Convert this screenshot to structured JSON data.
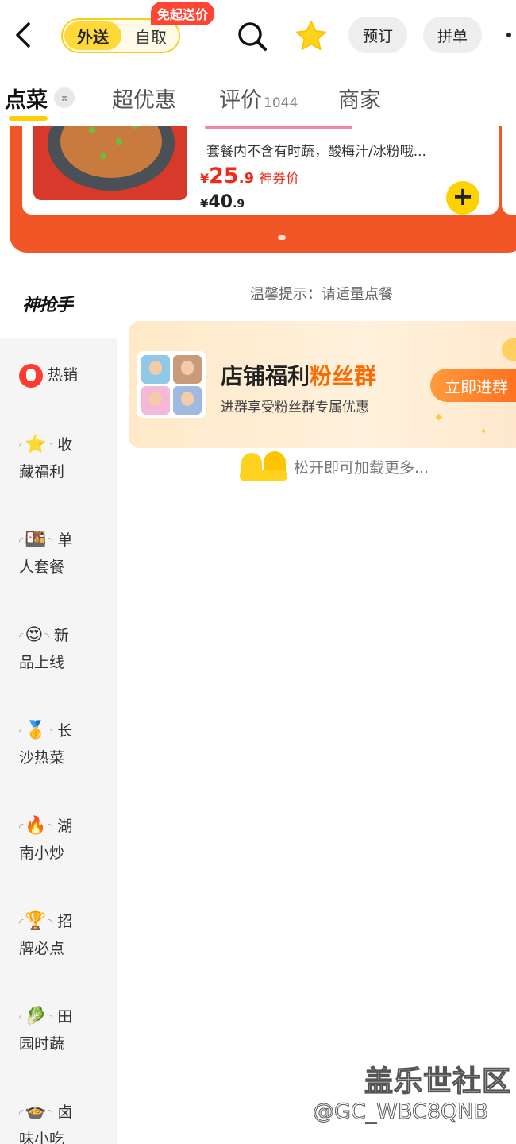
{
  "header": {
    "mode_active": "外送",
    "mode_inactive": "自取",
    "mode_badge": "免起送价",
    "btn_reserve": "预订",
    "btn_group": "拼单"
  },
  "tabs": [
    {
      "label": "点菜",
      "active": true
    },
    {
      "label": "超优惠"
    },
    {
      "label": "评价",
      "count": "1044"
    },
    {
      "label": "商家"
    }
  ],
  "tab_up_icon": "⌅",
  "banner": {
    "desc": "套餐内不含有时蔬，酸梅汁/冰粉哦...",
    "price_symbol": "¥",
    "price_int": "25",
    "price_dec": ".9",
    "price_tag": "神券价",
    "orig_symbol": "¥",
    "orig_int": "40",
    "orig_dec": ".9",
    "add_label": "+"
  },
  "sidebar": {
    "brand": "神抢手",
    "categories": [
      {
        "label": "热销",
        "icon": "flame-icon"
      },
      {
        "label1": "收",
        "label2": "藏福利",
        "icon": "⭐"
      },
      {
        "label1": "单",
        "label2": "人套餐",
        "icon": "🍱"
      },
      {
        "label1": "新",
        "label2": "品上线",
        "icon": "😍"
      },
      {
        "label1": "长",
        "label2": "沙热菜",
        "icon": "🥇"
      },
      {
        "label1": "湖",
        "label2": "南小炒",
        "icon": "🔥"
      },
      {
        "label1": "招",
        "label2": "牌必点",
        "icon": "🏆"
      },
      {
        "label1": "田",
        "label2": "园时蔬",
        "icon": "🥬"
      },
      {
        "label1": "卤",
        "label2": "味小吃",
        "icon": "🍲"
      }
    ]
  },
  "main": {
    "tip": "温馨提示：请适量点餐",
    "fans_title_1": "店铺福利",
    "fans_title_2": "粉丝群",
    "fans_sub": "进群享受粉丝群专属优惠",
    "join_label": "立即进群",
    "load_more": "松开即可加载更多..."
  },
  "watermark": {
    "line1": "盖乐世社区",
    "line2": "@GC_WBC8QNB"
  },
  "colors": {
    "accent_yellow": "#ffd000",
    "banner_orange": "#f25526",
    "price_red": "#ee2a1b",
    "badge_red": "#ff4433"
  }
}
